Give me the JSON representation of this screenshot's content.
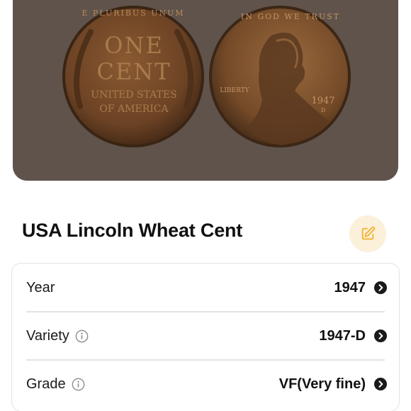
{
  "photo": {
    "alt": "Front and back of a wheat cent coin",
    "reverse_text": {
      "line1": "ONE",
      "line2": "CENT",
      "line3": "UNITED STATES",
      "line4": "OF AMERICA",
      "rim": "E PLURIBUS UNUM"
    },
    "obverse_text": {
      "rim": "IN GOD WE TRUST",
      "liberty": "LIBERTY",
      "year": "1947",
      "mint": "D"
    }
  },
  "title": "USA Lincoln Wheat Cent",
  "details": [
    {
      "label": "Year",
      "value": "1947",
      "has_info": false
    },
    {
      "label": "Variety",
      "value": "1947-D",
      "has_info": true
    },
    {
      "label": "Grade",
      "value": "VF(Very fine)",
      "has_info": true
    }
  ],
  "colors": {
    "photo_bg": "#5f534b",
    "accent": "#f2b233",
    "accent_bg": "#fbf0d9"
  },
  "icons": {
    "edit": "edit-icon",
    "info": "info-icon",
    "chevron": "chevron-right-circle-icon"
  }
}
